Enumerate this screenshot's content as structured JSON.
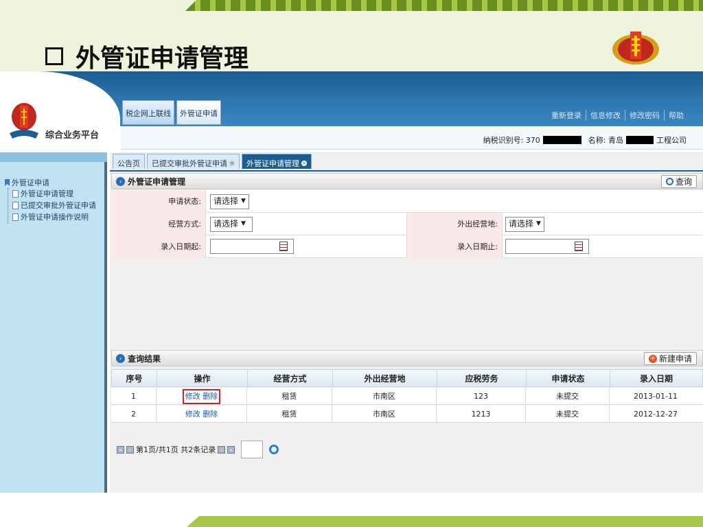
{
  "slide": {
    "title": "外管证申请管理",
    "title_marker_icon": "square-bullet-icon"
  },
  "header": {
    "brand_name": "综合业务平台",
    "tabs": [
      {
        "label": "税企网上联线"
      },
      {
        "label": "外管证申请"
      }
    ],
    "links": [
      "重新登录",
      "信息修改",
      "修改密码",
      "帮助"
    ],
    "taxpayer_id_label": "纳税识别号: 370",
    "name_label": "名称: 青岛",
    "name_suffix": "工程公司"
  },
  "sidebar": {
    "root": "外管证申请",
    "items": [
      "外管证申请管理",
      "已提交审批外管证申请",
      "外管证申请操作说明"
    ]
  },
  "content_tabs": [
    {
      "label": "公告页"
    },
    {
      "label": "已提交审批外管证申请"
    },
    {
      "label": "外管证申请管理"
    }
  ],
  "query_panel": {
    "title": "外管证申请管理",
    "query_button": "查询",
    "status_label": "申请状态:",
    "status_value": "请选择",
    "mode_label": "经营方式:",
    "mode_value": "请选择",
    "place_label": "外出经营地:",
    "place_value": "请选择",
    "date_from_label": "录入日期起:",
    "date_to_label": "录入日期止:"
  },
  "results": {
    "title": "查询结果",
    "new_button": "新建申请",
    "columns": [
      "序号",
      "操作",
      "经营方式",
      "外出经营地",
      "应税劳务",
      "申请状态",
      "录入日期"
    ],
    "rows": [
      {
        "no": "1",
        "edit": "修改",
        "delete": "删除",
        "mode": "租赁",
        "place": "市南区",
        "service": "123",
        "status": "未提交",
        "date": "2013-01-11"
      },
      {
        "no": "2",
        "edit": "修改",
        "delete": "删除",
        "mode": "租赁",
        "place": "市南区",
        "service": "1213",
        "status": "未提交",
        "date": "2012-12-27"
      }
    ]
  },
  "pager": {
    "text": "第1页/共1页 共2条记录"
  },
  "colors": {
    "header_blue": "#1c5d92",
    "accent_green": "#a9c84a",
    "highlight_red": "#d92020"
  }
}
